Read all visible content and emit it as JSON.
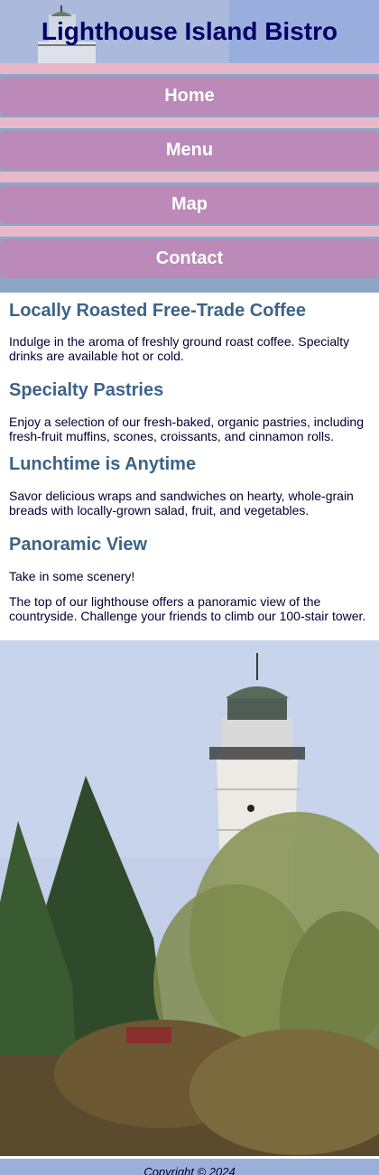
{
  "header": {
    "title": "Lighthouse Island Bistro"
  },
  "nav": {
    "items": [
      "Home",
      "Menu",
      "Map",
      "Contact"
    ]
  },
  "content": {
    "sections": [
      {
        "heading": "Locally Roasted Free-Trade Coffee",
        "paragraphs": [
          "Indulge in the aroma of freshly ground roast coffee. Specialty drinks are available hot or cold."
        ]
      },
      {
        "heading": "Specialty Pastries",
        "paragraphs": [
          "Enjoy a selection of our fresh-baked, organic pastries, including fresh-fruit muffins, scones, croissants, and cinnamon rolls."
        ]
      },
      {
        "heading": "Lunchtime is Anytime",
        "paragraphs": [
          "Savor delicious wraps and sandwiches on hearty, whole-grain breads with locally-grown salad, fruit, and vegetables."
        ]
      },
      {
        "heading": "Panoramic View",
        "paragraphs": [
          "Take in some scenery!",
          "The top of our lighthouse offers a panoramic view of the countryside. Challenge your friends to climb our 100-stair tower."
        ]
      }
    ]
  },
  "footer": {
    "copyright": "Copyright © 2024"
  }
}
